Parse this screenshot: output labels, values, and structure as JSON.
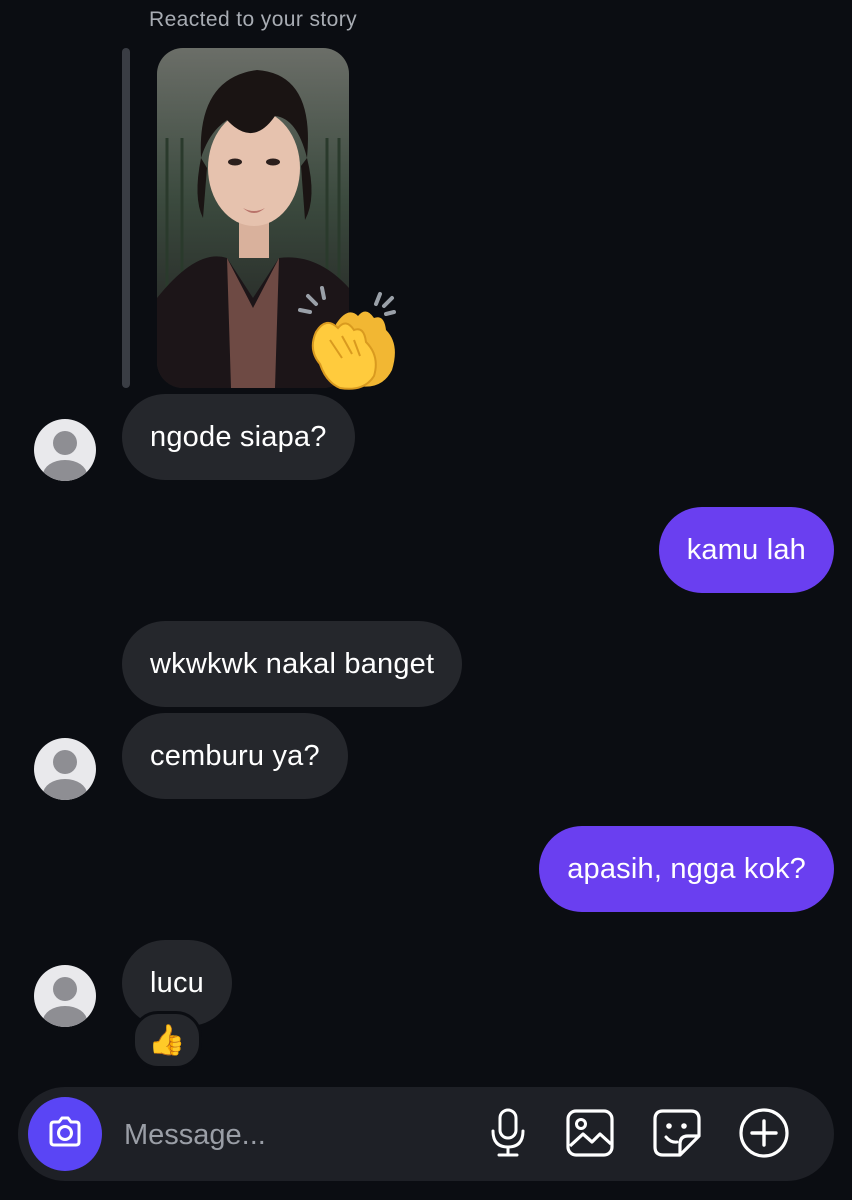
{
  "story": {
    "caption": "Reacted to your story",
    "reaction": "👏"
  },
  "messages": [
    {
      "text": "ngode siapa?",
      "side": "incoming"
    },
    {
      "text": "kamu lah",
      "side": "outgoing"
    },
    {
      "text": "wkwkwk nakal banget",
      "side": "incoming"
    },
    {
      "text": "cemburu ya?",
      "side": "incoming"
    },
    {
      "text": "apasih, ngga kok?",
      "side": "outgoing"
    },
    {
      "text": "lucu",
      "side": "incoming",
      "reaction": "👍"
    }
  ],
  "composer": {
    "placeholder": "Message...",
    "value": "",
    "icons": [
      "camera-icon",
      "microphone-icon",
      "gallery-icon",
      "sticker-icon",
      "plus-icon"
    ]
  },
  "colors": {
    "background": "#0b0d12",
    "incoming_bubble": "#25272c",
    "outgoing_bubble": "#6a3ff0",
    "camera_button": "#5a45f5",
    "composer": "#1e2026"
  }
}
